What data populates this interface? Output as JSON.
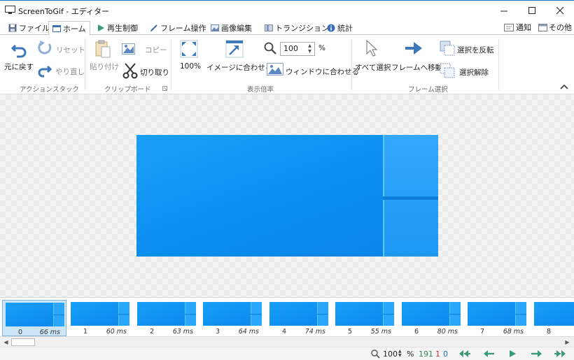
{
  "window": {
    "title": "ScreenToGif - エディター"
  },
  "tabs": [
    {
      "label": "ファイル"
    },
    {
      "label": "ホーム"
    },
    {
      "label": "再生制御"
    },
    {
      "label": "フレーム操作"
    },
    {
      "label": "画像編集"
    },
    {
      "label": "トランジション"
    },
    {
      "label": "統計"
    }
  ],
  "header_right": {
    "notify": "通知",
    "other": "その他"
  },
  "ribbon": {
    "action_stack": {
      "undo": "元に戻す",
      "reset": "リセット",
      "redo": "やり直し",
      "title": "アクションスタック"
    },
    "clipboard": {
      "paste": "貼り付け",
      "copy": "コピー",
      "cut": "切り取り",
      "title": "クリップボード"
    },
    "zoom": {
      "zoom100": "100%",
      "fit_image": "イメージに合わせる",
      "zoom_value": "100",
      "percent": "%",
      "fit_window": "ウィンドウに合わせる",
      "title": "表示倍率"
    },
    "frame_select": {
      "select_all": "すべて選択",
      "go_to_frame": "フレームへ移動",
      "invert": "選択を反転",
      "deselect": "選択解除",
      "title": "フレーム選択"
    }
  },
  "frames": [
    {
      "index": "0",
      "delay": "66 ms"
    },
    {
      "index": "1",
      "delay": "60 ms"
    },
    {
      "index": "2",
      "delay": "63 ms"
    },
    {
      "index": "3",
      "delay": "64 ms"
    },
    {
      "index": "4",
      "delay": "74 ms"
    },
    {
      "index": "5",
      "delay": "55 ms"
    },
    {
      "index": "6",
      "delay": "80 ms"
    },
    {
      "index": "7",
      "delay": "68 ms"
    },
    {
      "index": "8",
      "delay": ""
    }
  ],
  "status": {
    "zoom": "100",
    "percent": "%",
    "total_frames": "191",
    "selected_frames": "1",
    "current_frame": "0"
  },
  "colors": {
    "accent": "#1a73c7",
    "frame_blue": "#0b8df0",
    "nav_green": "#3a9a74",
    "total_green": "#2e8b57",
    "selected_red": "#d0342c",
    "current_blue": "#1a73c7"
  }
}
